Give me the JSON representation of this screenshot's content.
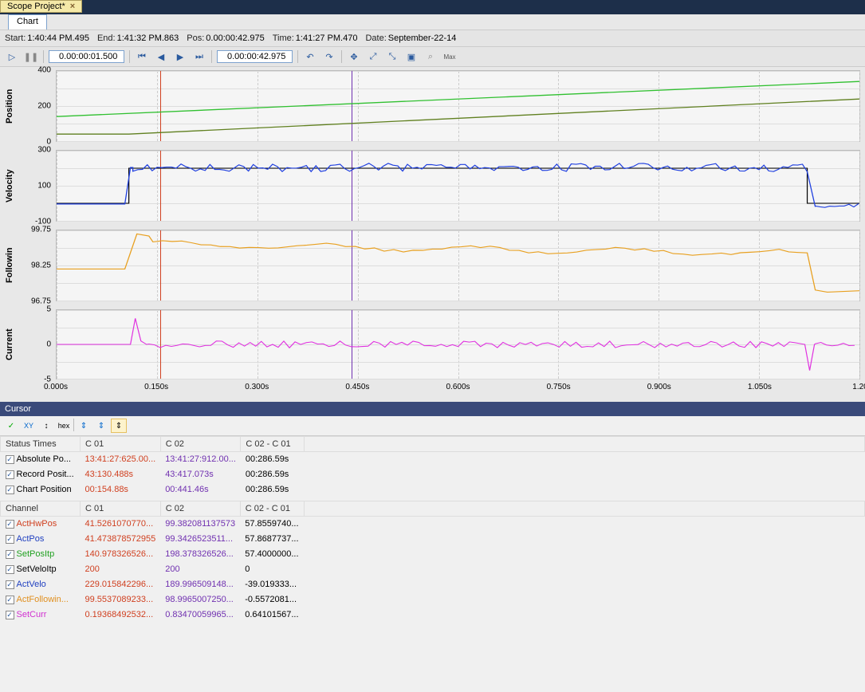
{
  "tab_title": "Scope Project*",
  "sub_tab": "Chart",
  "info_bar": {
    "start_label": "Start:",
    "start_value": "1:40:44 PM.495",
    "end_label": "End:",
    "end_value": "1:41:32 PM.863",
    "pos_label": "Pos:",
    "pos_value": "0.00:00:42.975",
    "time_label": "Time:",
    "time_value": "1:41:27 PM.470",
    "date_label": "Date:",
    "date_value": "September-22-14"
  },
  "timebox1": "0.00:00:01.500",
  "timebox2": "0.00:00:42.975",
  "charts": [
    {
      "label": "Position",
      "ticks": [
        "400",
        "200",
        "0"
      ],
      "height": 90
    },
    {
      "label": "Velocity",
      "ticks": [
        "300",
        "100",
        "-100"
      ],
      "height": 90
    },
    {
      "label": "Followin",
      "ticks": [
        "99.75",
        "98.25",
        "96.75"
      ],
      "height": 90
    },
    {
      "label": "Current",
      "ticks": [
        "5",
        "0",
        "-5"
      ],
      "height": 88
    }
  ],
  "x_ticks": [
    "0.000s",
    "0.150s",
    "0.300s",
    "0.450s",
    "0.600s",
    "0.750s",
    "0.900s",
    "1.050s",
    "1.20"
  ],
  "cursor_panel": "Cursor",
  "status_header": [
    "Status Times",
    "C 01",
    "C 02",
    "C 02 - C 01"
  ],
  "status_rows": [
    {
      "name": "Absolute Po...",
      "c01": "13:41:27:625.00...",
      "c02": "13:41:27:912.00...",
      "diff": "00:286.59s",
      "col1_color": "#d04020",
      "col2_color": "#7030b0"
    },
    {
      "name": "Record Posit...",
      "c01": "43:130.488s",
      "c02": "43:417.073s",
      "diff": "00:286.59s",
      "col1_color": "#d04020",
      "col2_color": "#7030b0"
    },
    {
      "name": "Chart Position",
      "c01": "00:154.88s",
      "c02": "00:441.46s",
      "diff": "00:286.59s",
      "col1_color": "#d04020",
      "col2_color": "#7030b0"
    }
  ],
  "channel_header": [
    "Channel",
    "C 01",
    "C 02",
    "C 02 - C 01"
  ],
  "channel_rows": [
    {
      "name": "ActHwPos",
      "c01": "41.5261070770...",
      "c02": "99.382081137573",
      "diff": "57.8559740...",
      "name_color": "#d04020"
    },
    {
      "name": "ActPos",
      "c01": "41.473878572955",
      "c02": "99.3426523511...",
      "diff": "57.8687737...",
      "name_color": "#2040c0"
    },
    {
      "name": "SetPosItp",
      "c01": "140.978326526...",
      "c02": "198.378326526...",
      "diff": "57.4000000...",
      "name_color": "#20a020"
    },
    {
      "name": "SetVeloItp",
      "c01": "200",
      "c02": "200",
      "diff": "0",
      "name_color": "#000"
    },
    {
      "name": "ActVelo",
      "c01": "229.015842296...",
      "c02": "189.996509148...",
      "diff": "-39.019333...",
      "name_color": "#2040c0"
    },
    {
      "name": "ActFollowin...",
      "c01": "99.5537089233...",
      "c02": "98.9965007250...",
      "diff": "-0.5572081...",
      "name_color": "#e09020"
    },
    {
      "name": "SetCurr",
      "c01": "0.19368492532...",
      "c02": "0.83470059965...",
      "diff": "0.64101567...",
      "name_color": "#d030d0"
    }
  ],
  "chart_data": {
    "type": "line",
    "x_range": [
      0.0,
      1.2
    ],
    "x_unit": "s",
    "cursors": {
      "c01": 0.155,
      "c02": 0.441
    },
    "series": [
      {
        "name": "SetPosItp",
        "chart": "Position",
        "color": "#30c030",
        "y_start": 141,
        "y_end": 340
      },
      {
        "name": "ActPos",
        "chart": "Position",
        "color": "#608020",
        "y_start": 41,
        "y_end": 240
      },
      {
        "name": "SetVeloItp",
        "chart": "Velocity",
        "color": "#000",
        "values_desc": "0 until ~0.11s, step to 200, back to 0 at ~1.12s"
      },
      {
        "name": "ActVelo",
        "chart": "Velocity",
        "color": "#2040e0",
        "values_desc": "0 until ~0.11s, noisy around 200, drop at ~1.12s"
      },
      {
        "name": "ActFollowing",
        "chart": "Followin",
        "color": "#e8a020",
        "values_desc": "~98 baseline, spike to ~99.8 at 0.13s, decaying, dip at ~1.12s to ~97"
      },
      {
        "name": "SetCurr",
        "chart": "Current",
        "color": "#e030e0",
        "values_desc": "~0 baseline, spike to ~4 at 0.12s, small noise ±0.5, negative spike ~-4 at 1.12s"
      }
    ]
  }
}
